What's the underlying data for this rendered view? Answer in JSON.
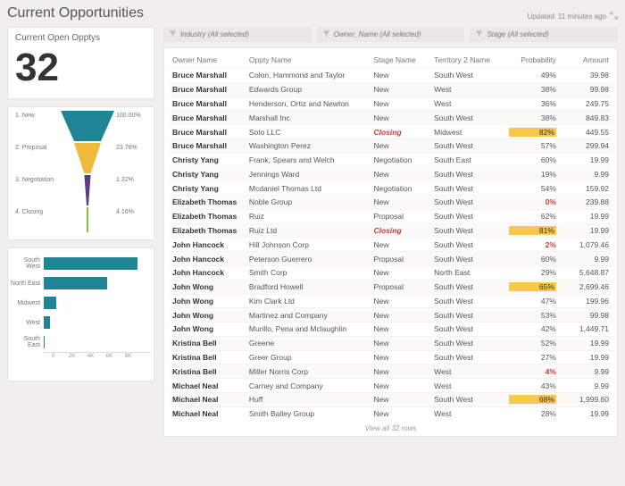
{
  "header": {
    "title": "Current Opportunities",
    "updated_prefix": "Updated ",
    "updated_text": "11 minutes ago"
  },
  "filters": [
    {
      "label": "Industry (All selected)"
    },
    {
      "label": "Owner_Name (All selected)"
    },
    {
      "label": "Stage (All selected)"
    }
  ],
  "kpi": {
    "title": "Current Open Opptys",
    "value": "32"
  },
  "chart_data": [
    {
      "type": "funnel",
      "stages": [
        {
          "label": "1. New",
          "pct": "100.00%",
          "value": 100.0,
          "color": "#1f8595"
        },
        {
          "label": "2. Proposal",
          "pct": "23.76%",
          "value": 23.76,
          "color": "#f0b93a"
        },
        {
          "label": "3. Negotiation",
          "pct": "1.32%",
          "value": 1.32,
          "color": "#5a3d82"
        },
        {
          "label": "4. Closing",
          "pct": "4.16%",
          "value": 4.16,
          "color": "#80c23c"
        }
      ]
    },
    {
      "type": "bar",
      "orientation": "horizontal",
      "title": "",
      "xlabel": "",
      "ylabel": "",
      "xlim": [
        0,
        8000
      ],
      "categories": [
        "South West",
        "North East",
        "Midwest",
        "West",
        "South East"
      ],
      "values": [
        8400,
        5400,
        1100,
        500,
        100
      ],
      "ticks": [
        "0",
        "2K",
        "4K",
        "6K",
        "8K"
      ],
      "color": "#1f8595"
    }
  ],
  "table": {
    "cols": [
      "Owner Name",
      "Oppty Name",
      "Stage Name",
      "Territory 2 Name",
      "Probability",
      "Amount"
    ],
    "view_all": "View all 32 rows",
    "rows": [
      {
        "on": "Bruce Marshall",
        "op": "Colon, Hammond and Taylor",
        "sn": "New",
        "tn": "South West",
        "pr": "49%",
        "am": "39.98"
      },
      {
        "on": "Bruce Marshall",
        "op": "Edwards Group",
        "sn": "New",
        "tn": "West",
        "pr": "38%",
        "am": "99.98"
      },
      {
        "on": "Bruce Marshall",
        "op": "Henderson, Ortiz and Newton",
        "sn": "New",
        "tn": "West",
        "pr": "36%",
        "am": "249.75"
      },
      {
        "on": "Bruce Marshall",
        "op": "Marshall Inc",
        "sn": "New",
        "tn": "South West",
        "pr": "38%",
        "am": "849.83"
      },
      {
        "on": "Bruce Marshall",
        "op": "Soto LLC",
        "sn": "Closing",
        "closing": true,
        "tn": "Midwest",
        "pr": "82%",
        "hl": true,
        "am": "449.55"
      },
      {
        "on": "Bruce Marshall",
        "op": "Washington Perez",
        "sn": "New",
        "tn": "South West",
        "pr": "57%",
        "am": "299.94"
      },
      {
        "on": "Christy Yang",
        "op": "Frank, Spears and Welch",
        "sn": "Negotiation",
        "tn": "South East",
        "pr": "60%",
        "am": "19.99"
      },
      {
        "on": "Christy Yang",
        "op": "Jennings Ward",
        "sn": "New",
        "tn": "South West",
        "pr": "19%",
        "am": "9.99"
      },
      {
        "on": "Christy Yang",
        "op": "Mcdaniel Thomas Ltd",
        "sn": "Negotiation",
        "tn": "South West",
        "pr": "54%",
        "am": "159.92"
      },
      {
        "on": "Elizabeth Thomas",
        "op": "Noble Group",
        "sn": "New",
        "tn": "South West",
        "pr": "0%",
        "red": true,
        "am": "239.88"
      },
      {
        "on": "Elizabeth Thomas",
        "op": "Ruiz",
        "sn": "Proposal",
        "tn": "South West",
        "pr": "62%",
        "am": "19.99"
      },
      {
        "on": "Elizabeth Thomas",
        "op": "Ruiz Ltd",
        "sn": "Closing",
        "closing": true,
        "tn": "South West",
        "pr": "81%",
        "hl": true,
        "am": "19.99"
      },
      {
        "on": "John Hancock",
        "op": "Hill Johnson Corp",
        "sn": "New",
        "tn": "South West",
        "pr": "2%",
        "red": true,
        "am": "1,079.46"
      },
      {
        "on": "John Hancock",
        "op": "Peterson Guerrero",
        "sn": "Proposal",
        "tn": "South West",
        "pr": "60%",
        "am": "9.99"
      },
      {
        "on": "John Hancock",
        "op": "Smith Corp",
        "sn": "New",
        "tn": "North East",
        "pr": "29%",
        "am": "5,648.87"
      },
      {
        "on": "John Wong",
        "op": "Bradford Howell",
        "sn": "Proposal",
        "tn": "South West",
        "pr": "65%",
        "hl": true,
        "am": "2,699.46"
      },
      {
        "on": "John Wong",
        "op": "Kim Clark Ltd",
        "sn": "New",
        "tn": "South West",
        "pr": "47%",
        "am": "199.96"
      },
      {
        "on": "John Wong",
        "op": "Martinez and Company",
        "sn": "New",
        "tn": "South West",
        "pr": "53%",
        "am": "99.98"
      },
      {
        "on": "John Wong",
        "op": "Murillo, Pena and Mclaughlin",
        "sn": "New",
        "tn": "South West",
        "pr": "42%",
        "am": "1,449.71"
      },
      {
        "on": "Kristina Bell",
        "op": "Greene",
        "sn": "New",
        "tn": "South West",
        "pr": "52%",
        "am": "19.99"
      },
      {
        "on": "Kristina Bell",
        "op": "Greer Group",
        "sn": "New",
        "tn": "South West",
        "pr": "27%",
        "am": "19.99"
      },
      {
        "on": "Kristina Bell",
        "op": "Miller Norris Corp",
        "sn": "New",
        "tn": "West",
        "pr": "4%",
        "red": true,
        "am": "9.99"
      },
      {
        "on": "Michael Neal",
        "op": "Carney and Company",
        "sn": "New",
        "tn": "West",
        "pr": "43%",
        "am": "9.99"
      },
      {
        "on": "Michael Neal",
        "op": "Huff",
        "sn": "New",
        "tn": "South West",
        "pr": "68%",
        "hl": true,
        "am": "1,999.60"
      },
      {
        "on": "Michael Neal",
        "op": "Smith Bailey Group",
        "sn": "New",
        "tn": "West",
        "pr": "28%",
        "am": "19.99"
      }
    ]
  }
}
